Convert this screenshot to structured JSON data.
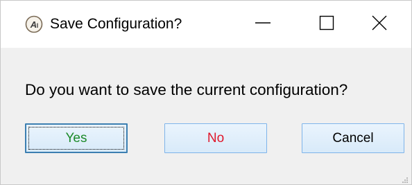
{
  "window": {
    "title": "Save Configuration?",
    "app_icon_letters": "AI"
  },
  "caption_buttons": {
    "minimize_icon": "minimize-icon",
    "maximize_icon": "maximize-icon",
    "close_icon": "close-icon"
  },
  "dialog": {
    "message": "Do you want to save the current configuration?",
    "buttons": {
      "yes": "Yes",
      "no": "No",
      "cancel": "Cancel"
    },
    "focused_button": "yes"
  },
  "colors": {
    "yes_text": "#1c8a2a",
    "no_text": "#e0182c",
    "cancel_text": "#000000",
    "button_border": "#7eb4ea",
    "button_fill": "#dcecfc",
    "dialog_bg": "#f0f0f0"
  }
}
